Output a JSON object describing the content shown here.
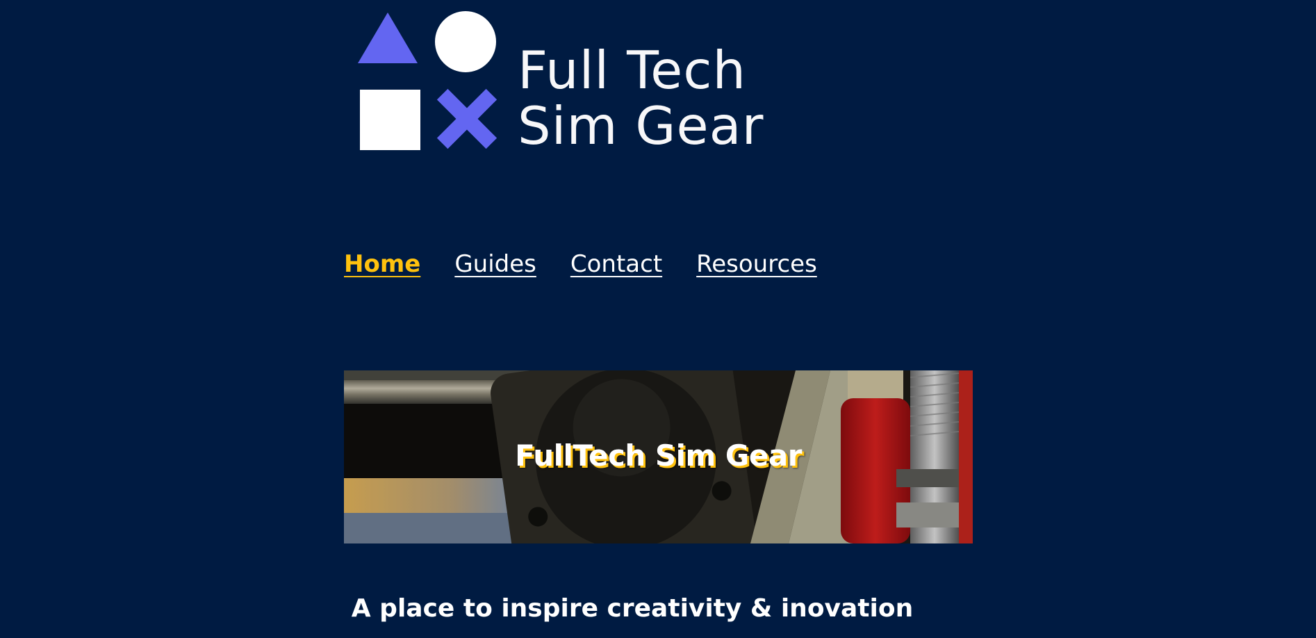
{
  "logo": {
    "line1": "Full Tech",
    "line2": "Sim Gear",
    "icons": [
      "triangle-icon",
      "circle-icon",
      "square-icon",
      "cross-icon"
    ]
  },
  "nav": {
    "items": [
      {
        "label": "Home",
        "active": true
      },
      {
        "label": "Guides",
        "active": false
      },
      {
        "label": "Contact",
        "active": false
      },
      {
        "label": "Resources",
        "active": false
      }
    ]
  },
  "hero": {
    "title": "FullTech Sim Gear"
  },
  "tagline": "A place to inspire creativity & inovation",
  "colors": {
    "background": "#001b42",
    "accent": "#ffc20e",
    "logo_shape": "#6366f1",
    "text": "#ffffff"
  }
}
